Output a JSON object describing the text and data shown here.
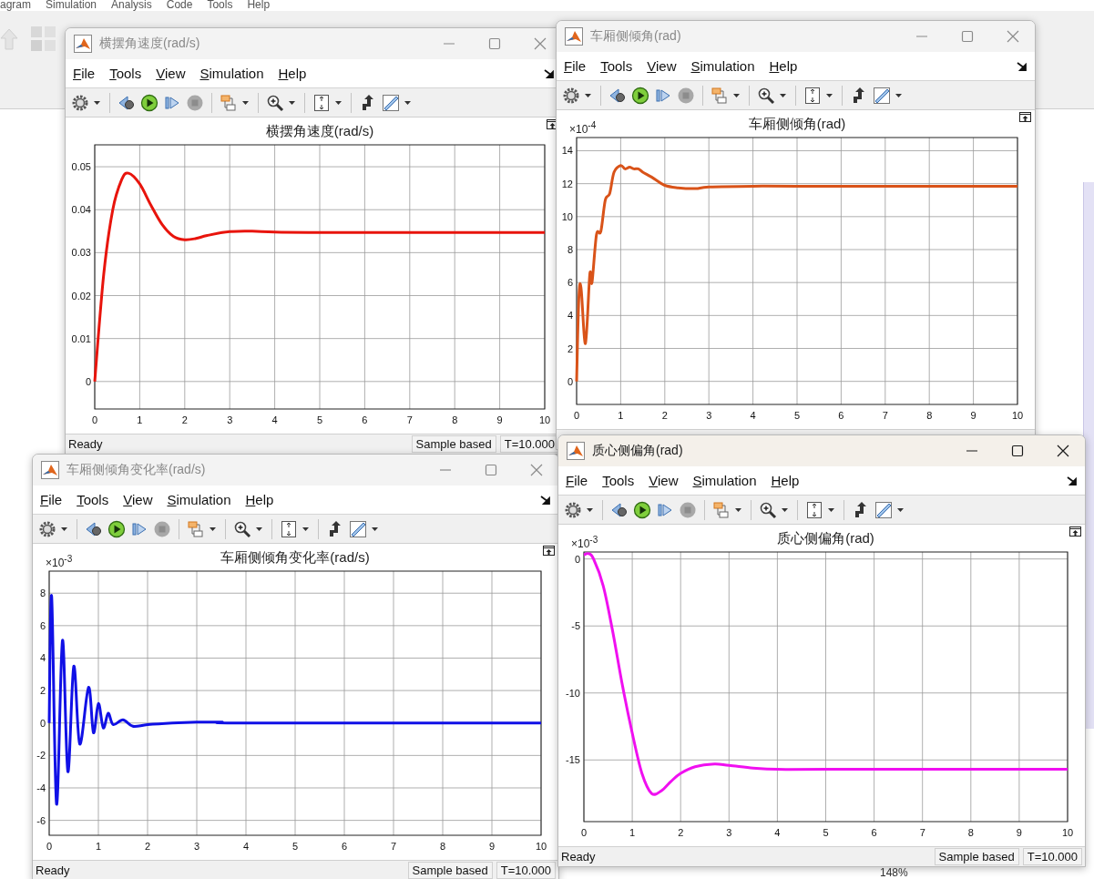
{
  "background": {
    "menu": [
      "agram",
      "Simulation",
      "Analysis",
      "Code",
      "Tools",
      "Help"
    ],
    "zoom_level": "148%"
  },
  "windows": [
    {
      "title": "横摆角速度(rad/s)",
      "active": false,
      "menu": [
        {
          "label": "File"
        },
        {
          "label": "Tools"
        },
        {
          "label": "View"
        },
        {
          "label": "Simulation"
        },
        {
          "label": "Help"
        }
      ],
      "chart_data": {
        "type": "line",
        "title": "横摆角速度(rad/s)",
        "x": [
          0,
          0.2,
          0.4,
          0.6,
          0.75,
          1,
          1.25,
          1.5,
          1.75,
          2,
          2.25,
          2.5,
          3,
          3.5,
          4,
          5,
          6,
          7,
          8,
          9,
          10
        ],
        "grid": true,
        "series": [
          {
            "color": "#e8140c",
            "values": [
              0,
              0.025,
              0.04,
              0.047,
              0.0485,
              0.046,
              0.041,
              0.0365,
              0.0338,
              0.033,
              0.0333,
              0.034,
              0.0349,
              0.035,
              0.0348,
              0.0347,
              0.0347,
              0.0347,
              0.0347,
              0.0347,
              0.0347
            ]
          }
        ],
        "xlim": [
          0,
          10
        ],
        "ylim": [
          -0.0064,
          0.0551
        ],
        "xticks": [
          0,
          1,
          2,
          3,
          4,
          5,
          6,
          7,
          8,
          9,
          10
        ],
        "yticks": [
          0,
          0.01,
          0.02,
          0.03,
          0.04,
          0.05
        ]
      },
      "status_bar": {
        "text": "Ready",
        "fields": [
          "Sample based",
          "T=10.000"
        ]
      }
    },
    {
      "title": "车厢侧倾角(rad)",
      "active": false,
      "menu": [
        {
          "label": "File"
        },
        {
          "label": "Tools"
        },
        {
          "label": "View"
        },
        {
          "label": "Simulation"
        },
        {
          "label": "Help"
        }
      ],
      "chart_data": {
        "type": "line",
        "title": "车厢侧倾角(rad)",
        "ylabel": "×10$^{-4}$",
        "x": [
          0,
          0.05,
          0.1,
          0.2,
          0.3,
          0.35,
          0.45,
          0.55,
          0.65,
          0.75,
          0.85,
          1,
          1.1,
          1.2,
          1.3,
          1.4,
          1.5,
          1.7,
          2,
          2.3,
          2.7,
          3,
          4,
          5,
          10
        ],
        "grid": true,
        "series": [
          {
            "color": "#d95319",
            "values": [
              0,
              5,
              5.7,
              2.3,
              6.5,
              6,
              8.9,
              9.1,
              11,
              11.4,
              12.7,
              13.1,
              12.9,
              13,
              12.9,
              12.9,
              12.7,
              12.4,
              11.9,
              11.75,
              11.7,
              11.8,
              11.85,
              11.85,
              11.85
            ]
          }
        ],
        "xlim": [
          0,
          10
        ],
        "ylim": [
          -1.4,
          14.8
        ],
        "xticks": [
          0,
          1,
          2,
          3,
          4,
          5,
          6,
          7,
          8,
          9,
          10
        ],
        "yticks": [
          0,
          2,
          4,
          6,
          8,
          10,
          12,
          14
        ]
      }
    },
    {
      "title": "车厢侧倾角变化率(rad/s)",
      "active": false,
      "menu": [
        {
          "label": "File"
        },
        {
          "label": "Tools"
        },
        {
          "label": "View"
        },
        {
          "label": "Simulation"
        },
        {
          "label": "Help"
        }
      ],
      "chart_data": {
        "type": "line",
        "title": "车厢侧倾角变化率(rad/s)",
        "ylabel": "×10$^{-3}$",
        "x": [
          0,
          0.05,
          0.15,
          0.27,
          0.38,
          0.5,
          0.62,
          0.8,
          0.9,
          1,
          1.1,
          1.2,
          1.3,
          1.5,
          1.7,
          2,
          2.5,
          3,
          3.5,
          4,
          10
        ],
        "grid": true,
        "series": [
          {
            "color": "#1010e6",
            "values": [
              0,
              7.8,
              -5,
              5.1,
              -3,
              3.5,
              -1.3,
              2.2,
              -0.6,
              1.2,
              -0.3,
              0.6,
              -0.1,
              0.2,
              -0.2,
              -0.1,
              0,
              0.05,
              0.05,
              0,
              0
            ]
          }
        ],
        "xlim": [
          0,
          10
        ],
        "ylim": [
          -6.92,
          9.36
        ],
        "xticks": [
          0,
          1,
          2,
          3,
          4,
          5,
          6,
          7,
          8,
          9,
          10
        ],
        "yticks": [
          -6,
          -4,
          -2,
          0,
          2,
          4,
          6,
          8
        ]
      },
      "status_bar": {
        "text": "Ready",
        "fields": [
          "Sample based",
          "T=10.000"
        ]
      }
    },
    {
      "title": "质心侧偏角(rad)",
      "active": true,
      "menu": [
        {
          "label": "File"
        },
        {
          "label": "Tools"
        },
        {
          "label": "View"
        },
        {
          "label": "Simulation"
        },
        {
          "label": "Help"
        }
      ],
      "chart_data": {
        "type": "line",
        "title": "质心侧偏角(rad)",
        "ylabel": "×10$^{-3}$",
        "x": [
          0,
          0.1,
          0.2,
          0.4,
          0.6,
          0.8,
          1,
          1.2,
          1.4,
          1.6,
          1.8,
          2,
          2.3,
          2.7,
          3,
          3.5,
          4,
          5,
          10
        ],
        "grid": true,
        "series": [
          {
            "color": "#f010f0",
            "values": [
              0.3,
              0.4,
              0,
              -2,
              -5.5,
              -9.5,
              -13,
              -16,
              -17.5,
              -17.3,
              -16.6,
              -16,
              -15.5,
              -15.3,
              -15.4,
              -15.6,
              -15.7,
              -15.7,
              -15.7
            ]
          }
        ],
        "xlim": [
          0,
          10
        ],
        "ylim": [
          -19.6,
          0.52
        ],
        "xticks": [
          0,
          1,
          2,
          3,
          4,
          5,
          6,
          7,
          8,
          9,
          10
        ],
        "yticks": [
          -15,
          -10,
          -5,
          0
        ]
      },
      "status_bar": {
        "text": "Ready",
        "fields": [
          "Sample based",
          "T=10.000"
        ]
      }
    }
  ]
}
